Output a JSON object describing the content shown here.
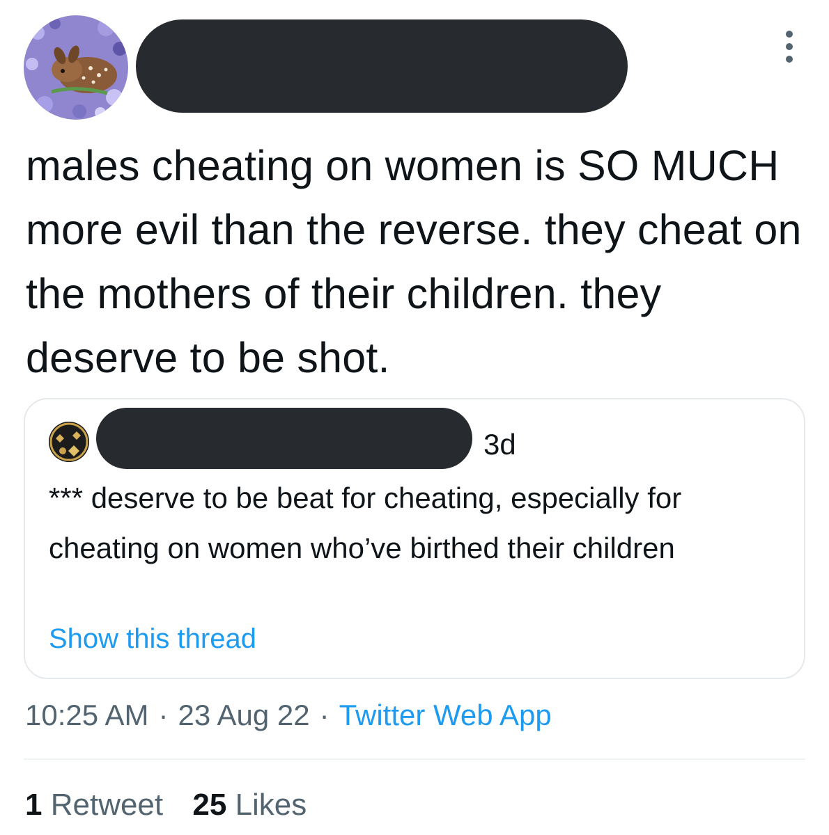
{
  "tweet": {
    "text": "males cheating on women is SO MUCH more evil than the reverse. they cheat on the mothers of their children. they deserve to be shot."
  },
  "quoted_tweet": {
    "age": "3d",
    "text": "*** deserve to be beat for cheating, especially for cheating on women who’ve birthed their children",
    "show_thread_label": "Show this thread"
  },
  "meta": {
    "time": "10:25 AM",
    "date": "23 Aug 22",
    "separator": "·",
    "source": "Twitter Web App"
  },
  "stats": {
    "retweets_count": "1",
    "retweets_label": "Retweet",
    "likes_count": "25",
    "likes_label": "Likes"
  },
  "icons": {
    "more": "more-vertical-icon"
  },
  "colors": {
    "accent": "#1d9bf0",
    "secondary_text": "#536471",
    "primary_text": "#0f1419",
    "redaction": "#272b30",
    "border": "#e6e9eb"
  }
}
